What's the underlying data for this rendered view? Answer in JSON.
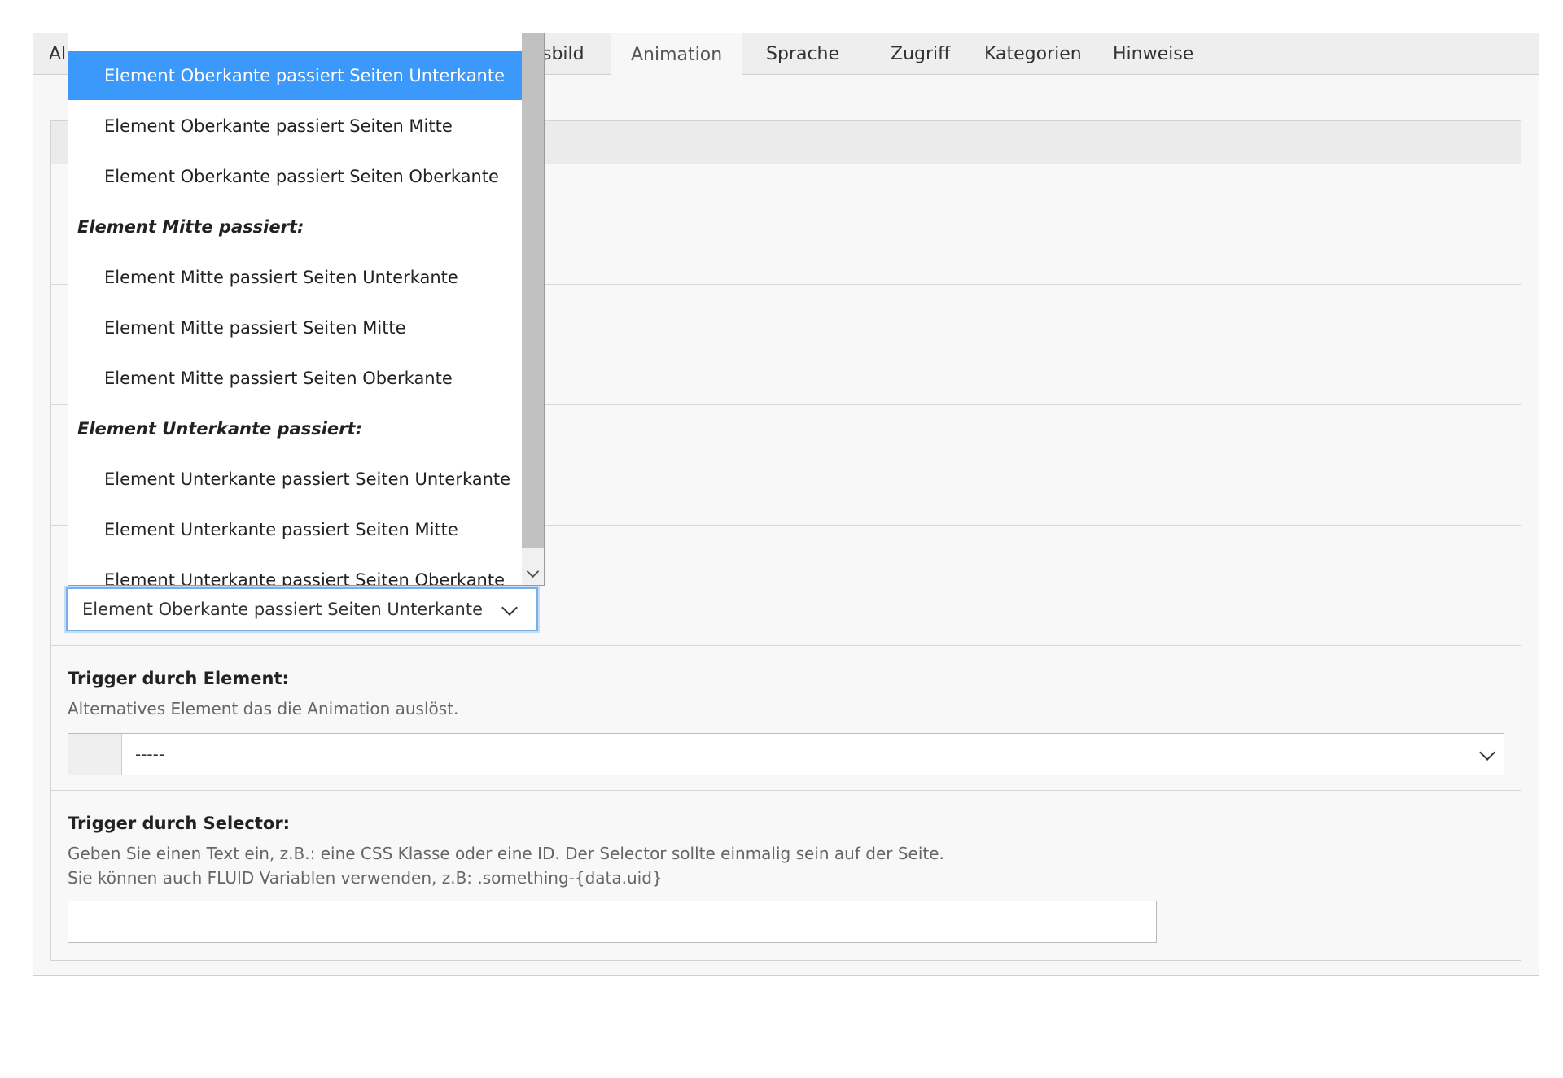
{
  "tabs": [
    {
      "label": "All",
      "active": false
    },
    {
      "label": "sbild",
      "active": false
    },
    {
      "label": "Animation",
      "active": true
    },
    {
      "label": "Sprache",
      "active": false
    },
    {
      "label": "Zugriff",
      "active": false
    },
    {
      "label": "Kategorien",
      "active": false
    },
    {
      "label": "Hinweise",
      "active": false
    }
  ],
  "position_select": {
    "value": "Element Oberkante passiert Seiten Unterkante"
  },
  "dropdown": {
    "items": [
      {
        "type": "option",
        "label": "Element Oberkante passiert Seiten Unterkante",
        "selected": true
      },
      {
        "type": "option",
        "label": "Element Oberkante passiert Seiten Mitte",
        "selected": false
      },
      {
        "type": "option",
        "label": "Element Oberkante passiert Seiten Oberkante",
        "selected": false
      },
      {
        "type": "group",
        "label": "Element Mitte passiert:"
      },
      {
        "type": "option",
        "label": "Element Mitte passiert Seiten Unterkante",
        "selected": false
      },
      {
        "type": "option",
        "label": "Element Mitte passiert Seiten Mitte",
        "selected": false
      },
      {
        "type": "option",
        "label": "Element Mitte passiert Seiten Oberkante",
        "selected": false
      },
      {
        "type": "group",
        "label": "Element Unterkante passiert:"
      },
      {
        "type": "option",
        "label": "Element Unterkante passiert Seiten Unterkante",
        "selected": false
      },
      {
        "type": "option",
        "label": "Element Unterkante passiert Seiten Mitte",
        "selected": false
      },
      {
        "type": "option",
        "label": "Element Unterkante passiert Seiten Oberkante",
        "selected": false
      }
    ]
  },
  "trigger_element": {
    "label": "Trigger durch Element:",
    "description": "Alternatives Element das die Animation auslöst.",
    "value": "-----"
  },
  "trigger_selector": {
    "label": "Trigger durch Selector:",
    "description_line1": "Geben Sie einen Text ein, z.B.: eine CSS Klasse oder eine ID. Der Selector sollte einmalig sein auf der Seite.",
    "description_line2": "Sie können auch FLUID Variablen verwenden, z.B: .something-{data.uid}",
    "value": ""
  },
  "colors": {
    "selected_option": "#3b99fc",
    "focus_border": "#7aaee8"
  }
}
